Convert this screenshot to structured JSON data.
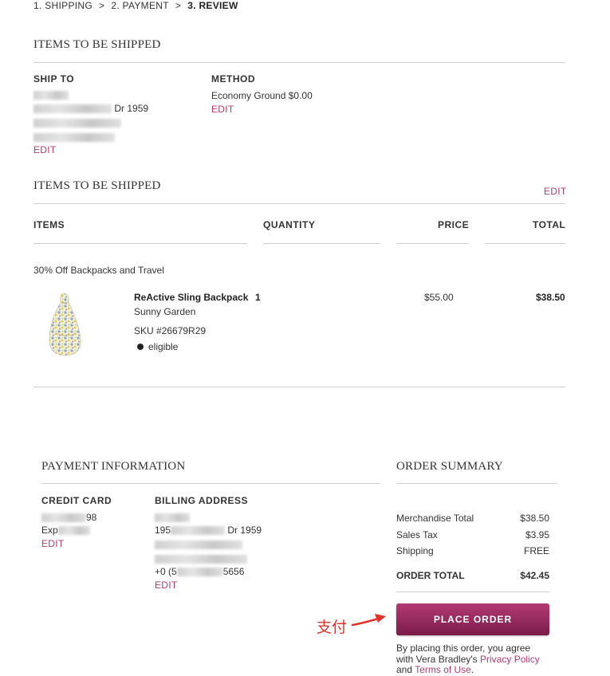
{
  "breadcrumb": {
    "step1": "1.  SHIPPING",
    "step2": "2.  PAYMENT",
    "step3": "3.  REVIEW",
    "separator": ">"
  },
  "shipping": {
    "title": "ITEMS TO BE SHIPPED",
    "ship_to_label": "SHIP TO",
    "address_line2_visible": "Dr 1959",
    "edit": "EDIT",
    "method_label": "METHOD",
    "method_value": "Economy Ground $0.00",
    "method_edit": "EDIT"
  },
  "items": {
    "title": "ITEMS TO BE SHIPPED",
    "edit": "EDIT",
    "col_items": "ITEMS",
    "col_quantity": "QUANTITY",
    "col_price": "PRICE",
    "col_total": "TOTAL",
    "promo": "30% Off Backpacks and Travel",
    "list": [
      {
        "name": "ReActive Sling Backpack",
        "quantity": "1",
        "variant": "Sunny Garden",
        "sku": "SKU #26679R29",
        "eligible": "eligible",
        "price": "$55.00",
        "total": "$38.50"
      }
    ]
  },
  "payment": {
    "title": "PAYMENT INFORMATION",
    "card_label": "CREDIT CARD",
    "card_last": "98",
    "card_exp_prefix": "Exp",
    "card_edit": "EDIT",
    "billing_label": "BILLING ADDRESS",
    "billing_line2_prefix": "195",
    "billing_line2_suffix": "Dr 1959",
    "billing_phone_prefix": "+0 (5",
    "billing_phone_suffix": "5656",
    "billing_edit": "EDIT"
  },
  "summary": {
    "title": "ORDER SUMMARY",
    "rows": [
      {
        "label": "Merchandise Total",
        "value": "$38.50"
      },
      {
        "label": "Sales Tax",
        "value": "$3.95"
      },
      {
        "label": "Shipping",
        "value": "FREE"
      }
    ],
    "total_label": "ORDER TOTAL",
    "total_value": "$42.45",
    "place_order": "PLACE  ORDER",
    "annotation": "支付",
    "disclaimer_1": "By placing this order, you agree",
    "disclaimer_2": "with Vera Bradley's",
    "privacy_link": "Privacy Policy",
    "disclaimer_3": "and",
    "terms_link": "Terms of Use",
    "period": "."
  },
  "colors": {
    "accent": "#b23a73",
    "button_top": "#b23a73",
    "button_bottom": "#7a1c4a",
    "annotation": "#e0342a"
  }
}
